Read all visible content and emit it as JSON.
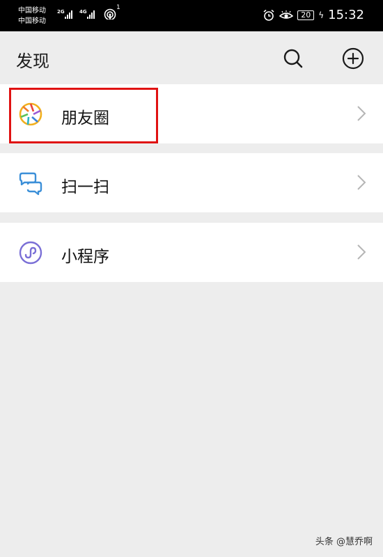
{
  "status_bar": {
    "carrier1": "中国移动",
    "carrier2": "中国移动",
    "network1": "2G",
    "network2": "4G",
    "hotspot_count": "1",
    "battery": "20",
    "time": "15:32"
  },
  "header": {
    "title": "发现",
    "icons": [
      "search-icon",
      "add-icon"
    ]
  },
  "menu": {
    "items": [
      {
        "label": "朋友圈",
        "icon": "moments-icon",
        "highlighted": true
      },
      {
        "label": "扫一扫",
        "icon": "scan-icon",
        "highlighted": false
      },
      {
        "label": "小程序",
        "icon": "mini-program-icon",
        "highlighted": false
      }
    ]
  },
  "watermark": "头条 @慧乔啊",
  "colors": {
    "background": "#ededed",
    "status_bar": "#000000",
    "highlight_box": "#e01212",
    "scan_icon": "#3b8fd8",
    "mini_program_icon": "#7a6fd6"
  }
}
